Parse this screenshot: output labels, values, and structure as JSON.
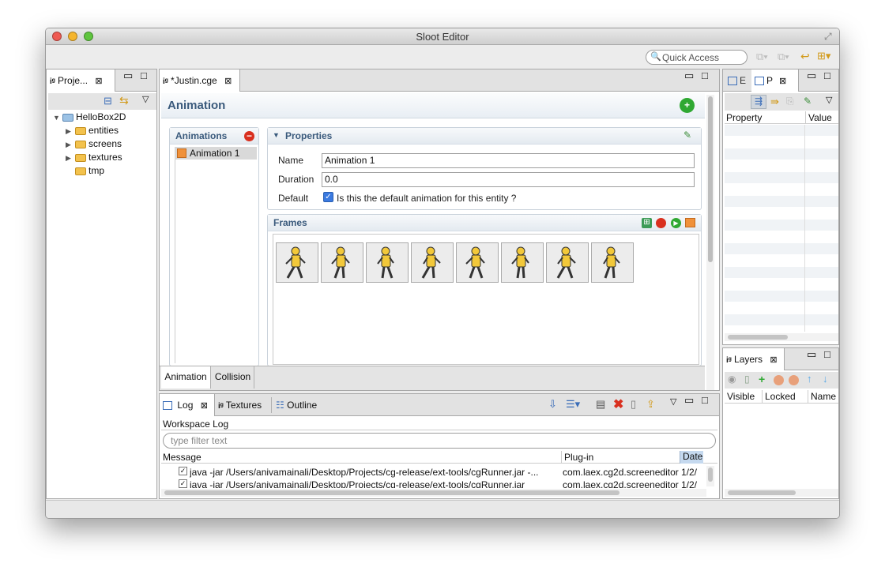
{
  "window": {
    "title": "Sloot Editor"
  },
  "toolbar": {
    "quick_access_placeholder": "Quick Access"
  },
  "project_explorer": {
    "tab_label": "Proje...",
    "root": "HelloBox2D",
    "items": [
      {
        "label": "entities",
        "expandable": true
      },
      {
        "label": "screens",
        "expandable": true
      },
      {
        "label": "textures",
        "expandable": true
      },
      {
        "label": "tmp",
        "expandable": false
      }
    ]
  },
  "editor": {
    "tab_label": "*Justin.cge",
    "header": "Animation",
    "animations": {
      "title": "Animations",
      "items": [
        "Animation 1"
      ]
    },
    "properties": {
      "title": "Properties",
      "name_label": "Name",
      "name_value": "Animation 1",
      "duration_label": "Duration",
      "duration_value": "0.0",
      "default_label": "Default",
      "default_text": "Is this the default animation for this entity ?",
      "default_checked": true
    },
    "frames": {
      "title": "Frames",
      "count": 8
    },
    "bottom_tabs": [
      "Animation",
      "Collision"
    ]
  },
  "right_top": {
    "tabs": [
      "E",
      "P"
    ],
    "columns": [
      "Property",
      "Value"
    ]
  },
  "layers": {
    "tab_label": "Layers",
    "columns": [
      "Visible",
      "Locked",
      "Name"
    ]
  },
  "log": {
    "tabs": [
      "Log",
      "Textures",
      "Outline"
    ],
    "workspace_label": "Workspace Log",
    "filter_placeholder": "type filter text",
    "columns": [
      "Message",
      "Plug-in",
      "Date"
    ],
    "rows": [
      {
        "message": "java -jar /Users/anivamainali/Desktop/Projects/cg-release/ext-tools/cgRunner.jar -...",
        "plugin": "com.laex.cg2d.screeneditor",
        "date": "1/2/"
      },
      {
        "message": "java -jar /Users/anivamainali/Desktop/Projects/cg-release/ext-tools/cgRunner.jar",
        "plugin": "com.laex.cg2d.screeneditor",
        "date": "1/2/"
      }
    ]
  },
  "colors": {
    "selection": "#c5d9ef",
    "section_title": "#3a5a7c",
    "add_green": "#2fa832",
    "remove_red": "#d9301f"
  }
}
